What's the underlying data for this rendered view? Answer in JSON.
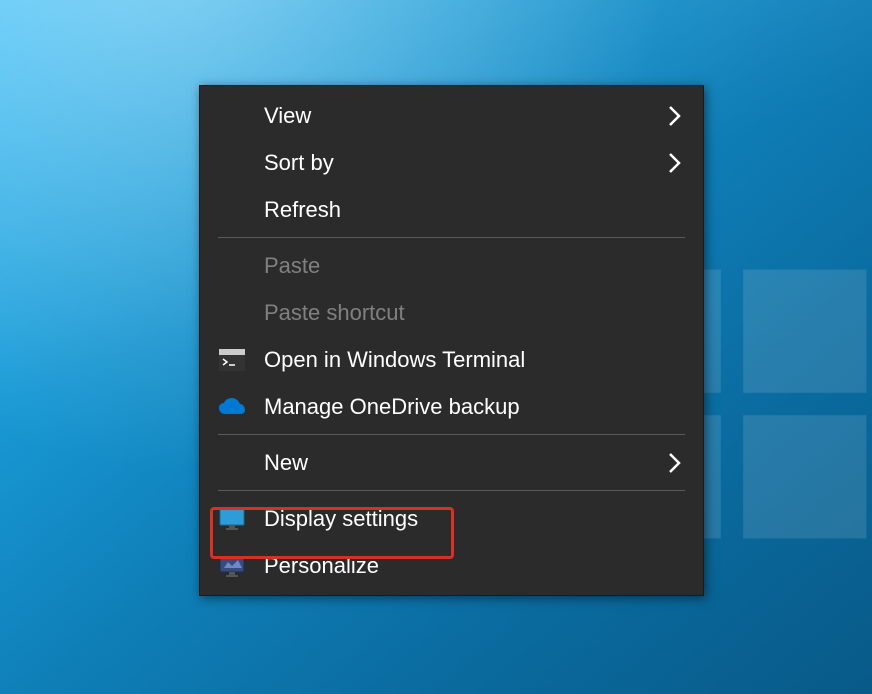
{
  "menu": {
    "items": [
      {
        "label": "View",
        "hasSubmenu": true,
        "enabled": true
      },
      {
        "label": "Sort by",
        "hasSubmenu": true,
        "enabled": true
      },
      {
        "label": "Refresh",
        "hasSubmenu": false,
        "enabled": true
      },
      {
        "label": "Paste",
        "hasSubmenu": false,
        "enabled": false
      },
      {
        "label": "Paste shortcut",
        "hasSubmenu": false,
        "enabled": false
      },
      {
        "label": "Open in Windows Terminal",
        "hasSubmenu": false,
        "enabled": true
      },
      {
        "label": "Manage OneDrive backup",
        "hasSubmenu": false,
        "enabled": true
      },
      {
        "label": "New",
        "hasSubmenu": true,
        "enabled": true
      },
      {
        "label": "Display settings",
        "hasSubmenu": false,
        "enabled": true
      },
      {
        "label": "Personalize",
        "hasSubmenu": false,
        "enabled": true
      }
    ]
  },
  "highlight": {
    "target": "Display settings"
  },
  "colors": {
    "menuBg": "#2b2b2b",
    "menuText": "#ffffff",
    "menuDisabled": "#808080",
    "highlightBorder": "#d93025"
  }
}
